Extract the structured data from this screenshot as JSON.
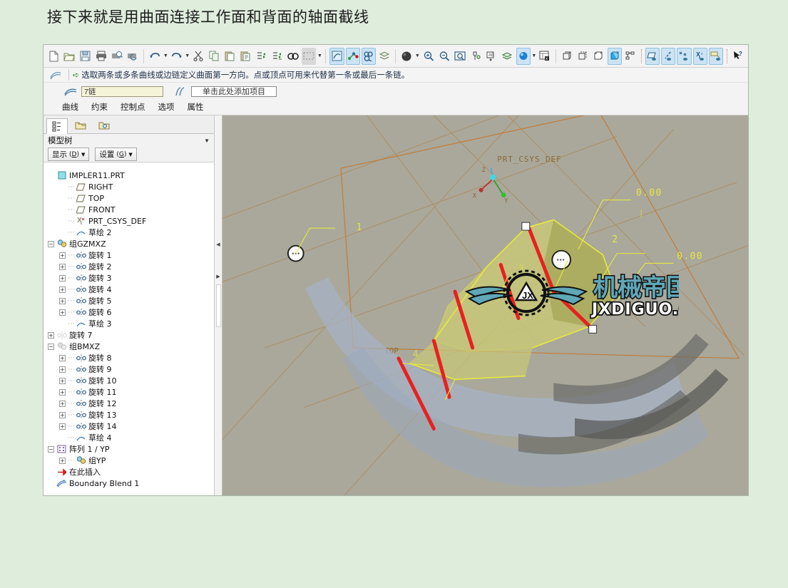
{
  "caption": "接下来就是用曲面连接工作面和背面的轴面截线",
  "toolbar": {
    "groups": [
      {
        "items": [
          {
            "name": "new-file-icon",
            "label": "新建"
          },
          {
            "name": "open-file-icon",
            "label": "打开"
          },
          {
            "name": "save-icon",
            "label": "保存"
          },
          {
            "name": "print-icon",
            "label": "打印"
          },
          {
            "name": "print-preview-icon",
            "label": "打印预览"
          },
          {
            "name": "mail-icon",
            "label": "发送"
          }
        ]
      },
      {
        "items": [
          {
            "name": "undo-icon",
            "label": "撤消",
            "dropdown": true
          },
          {
            "name": "redo-icon",
            "label": "重做",
            "dropdown": true
          },
          {
            "name": "cut-icon",
            "label": "剪切"
          },
          {
            "name": "copy-icon",
            "label": "复制"
          },
          {
            "name": "paste-icon",
            "label": "粘贴"
          },
          {
            "name": "paste-special-icon",
            "label": "选择性粘贴"
          },
          {
            "name": "regenerate-icon",
            "label": "再生"
          },
          {
            "name": "regenerate-all-icon",
            "label": "全部再生"
          },
          {
            "name": "find-icon",
            "label": "查找"
          },
          {
            "name": "select-box-icon",
            "label": "选取框",
            "dropdown": true,
            "state": "greyed"
          }
        ]
      },
      {
        "items": [
          {
            "name": "sketch-icon",
            "label": "草绘",
            "state": "selected"
          },
          {
            "name": "datum-point-icon",
            "label": "基准点",
            "state": "selected"
          },
          {
            "name": "analysis-icon",
            "label": "分析",
            "state": "selected"
          },
          {
            "name": "layer-box-icon",
            "label": "层"
          }
        ]
      },
      {
        "items": [
          {
            "name": "shading-sphere-icon",
            "label": "着色",
            "dropdown": true
          },
          {
            "name": "zoom-in-icon",
            "label": "放大"
          },
          {
            "name": "zoom-out-icon",
            "label": "缩小"
          },
          {
            "name": "refit-icon",
            "label": "重新调整"
          },
          {
            "name": "spin-center-icon",
            "label": "旋转中心"
          },
          {
            "name": "orient-mode-icon",
            "label": "定向模式"
          },
          {
            "name": "layers-icon",
            "label": "层树"
          },
          {
            "name": "saved-view-icon",
            "label": "已保存视图",
            "dropdown": true,
            "state": "selected"
          },
          {
            "name": "view-manager-icon",
            "label": "视图管理器"
          }
        ]
      },
      {
        "items": [
          {
            "name": "wireframe-icon",
            "label": "线框"
          },
          {
            "name": "hidden-line-icon",
            "label": "隐藏线"
          },
          {
            "name": "no-hidden-icon",
            "label": "消隐"
          },
          {
            "name": "shaded-icon",
            "label": "着色",
            "state": "selected"
          },
          {
            "name": "mechanism-icon",
            "label": "机构"
          }
        ]
      },
      {
        "items": [
          {
            "name": "datum-plane-toggle-icon",
            "label": "基准平面显示",
            "state": "selected"
          },
          {
            "name": "datum-axis-toggle-icon",
            "label": "基准轴显示",
            "state": "selected"
          },
          {
            "name": "datum-point-toggle-icon",
            "label": "基准点显示",
            "state": "selected"
          },
          {
            "name": "datum-csys-toggle-icon",
            "label": "坐标系显示",
            "state": "selected"
          },
          {
            "name": "annotation-toggle-icon",
            "label": "注释显示",
            "state": "selected"
          }
        ]
      },
      {
        "items": [
          {
            "name": "context-help-icon",
            "label": "上下文帮助"
          }
        ]
      }
    ]
  },
  "message": {
    "icon": "boundary-blend-icon",
    "arrow": "➪",
    "text": "选取两条或多条曲线或边链定义曲面第一方向。点或顶点可用来代替第一条或最后一条链。"
  },
  "dashboard": {
    "first_chain_icon": "first-direction-chain-icon",
    "first_chain_value": "7链",
    "second_chain_icon": "second-direction-chain-icon",
    "second_chain_placeholder": "单击此处添加项目",
    "tabs": [
      "曲线",
      "约束",
      "控制点",
      "选项",
      "属性"
    ]
  },
  "tree": {
    "tabs": [
      {
        "name": "model-tree-tab",
        "icon": "model-tree-icon",
        "active": true
      },
      {
        "name": "folder-browser-tab",
        "icon": "folder-icon",
        "active": false
      },
      {
        "name": "favorites-tab",
        "icon": "favorites-folder-icon",
        "active": false
      }
    ],
    "title": "模型树",
    "collapse_icon": "chevron-down-icon",
    "buttons": [
      {
        "name": "display-menu-button",
        "label": "显示",
        "mnemonic": "D"
      },
      {
        "name": "settings-menu-button",
        "label": "设置",
        "mnemonic": "G"
      }
    ],
    "items": [
      {
        "label": "IMPLER11.PRT",
        "icon": "part-icon",
        "indent": 0,
        "expander": "none"
      },
      {
        "label": "RIGHT",
        "icon": "datum-plane-icon",
        "indent": 1,
        "expander": "none"
      },
      {
        "label": "TOP",
        "icon": "datum-plane-icon",
        "indent": 1,
        "expander": "none"
      },
      {
        "label": "FRONT",
        "icon": "datum-plane-icon",
        "indent": 1,
        "expander": "none"
      },
      {
        "label": "PRT_CSYS_DEF",
        "icon": "csys-icon",
        "indent": 1,
        "expander": "none"
      },
      {
        "label": "草绘 2",
        "icon": "sketch-icon",
        "indent": 1,
        "expander": "none"
      },
      {
        "label": "组GZMXZ",
        "icon": "group-icon",
        "indent": 0,
        "expander": "minus"
      },
      {
        "label": "旋转 1",
        "icon": "revolve-icon",
        "indent": 1,
        "expander": "plus"
      },
      {
        "label": "旋转 2",
        "icon": "revolve-icon",
        "indent": 1,
        "expander": "plus"
      },
      {
        "label": "旋转 3",
        "icon": "revolve-icon",
        "indent": 1,
        "expander": "plus"
      },
      {
        "label": "旋转 4",
        "icon": "revolve-icon",
        "indent": 1,
        "expander": "plus"
      },
      {
        "label": "旋转 5",
        "icon": "revolve-icon",
        "indent": 1,
        "expander": "plus"
      },
      {
        "label": "旋转 6",
        "icon": "revolve-icon",
        "indent": 1,
        "expander": "plus"
      },
      {
        "label": "草绘 3",
        "icon": "sketch-icon",
        "indent": 1,
        "expander": "none"
      },
      {
        "label": "旋转 7",
        "icon": "revolve-suppressed-icon",
        "indent": 0,
        "expander": "plus"
      },
      {
        "label": "组BMXZ",
        "icon": "group-suppressed-icon",
        "indent": 0,
        "expander": "minus"
      },
      {
        "label": "旋转 8",
        "icon": "revolve-icon",
        "indent": 1,
        "expander": "plus"
      },
      {
        "label": "旋转 9",
        "icon": "revolve-icon",
        "indent": 1,
        "expander": "plus"
      },
      {
        "label": "旋转 10",
        "icon": "revolve-icon",
        "indent": 1,
        "expander": "plus"
      },
      {
        "label": "旋转 11",
        "icon": "revolve-icon",
        "indent": 1,
        "expander": "plus"
      },
      {
        "label": "旋转 12",
        "icon": "revolve-icon",
        "indent": 1,
        "expander": "plus"
      },
      {
        "label": "旋转 13",
        "icon": "revolve-icon",
        "indent": 1,
        "expander": "plus"
      },
      {
        "label": "旋转 14",
        "icon": "revolve-icon",
        "indent": 1,
        "expander": "plus"
      },
      {
        "label": "草绘 4",
        "icon": "sketch-icon",
        "indent": 1,
        "expander": "none"
      },
      {
        "label": "阵列 1 / YP",
        "icon": "pattern-icon",
        "indent": 0,
        "expander": "minus"
      },
      {
        "label": "组YP",
        "icon": "group-icon",
        "indent": 1,
        "expander": "plus"
      },
      {
        "label": "在此插入",
        "icon": "insert-here-icon",
        "indent": 0,
        "expander": "none"
      },
      {
        "label": "Boundary Blend 1",
        "icon": "boundary-blend-feature-icon",
        "indent": 0,
        "expander": "none"
      }
    ]
  },
  "splitter": {
    "collapse_left_icon": "triangle-left-icon",
    "collapse_right_icon": "triangle-right-icon"
  },
  "viewport": {
    "background_color": "#a9a89b",
    "csys_label": "PRT_CSYS_DEF",
    "csys_axes": [
      "X",
      "Y",
      "Z"
    ],
    "datum_labels": [
      "TOP"
    ],
    "chain_numbers": [
      "1",
      "2",
      "3",
      "4"
    ],
    "dimension_values": [
      "0.00",
      "0.00"
    ],
    "surface_color": "#c8c87a",
    "highlight_color": "#e02020",
    "preview_color": "#a8b6c8",
    "datum_line_color": "#c08a50",
    "accent_yellow": "#e8e840"
  },
  "watermark": {
    "title": "机械帝国",
    "url": "JXDIGUO.COM",
    "logo": "gear-wings-logo",
    "color": "#5fa8b8"
  }
}
